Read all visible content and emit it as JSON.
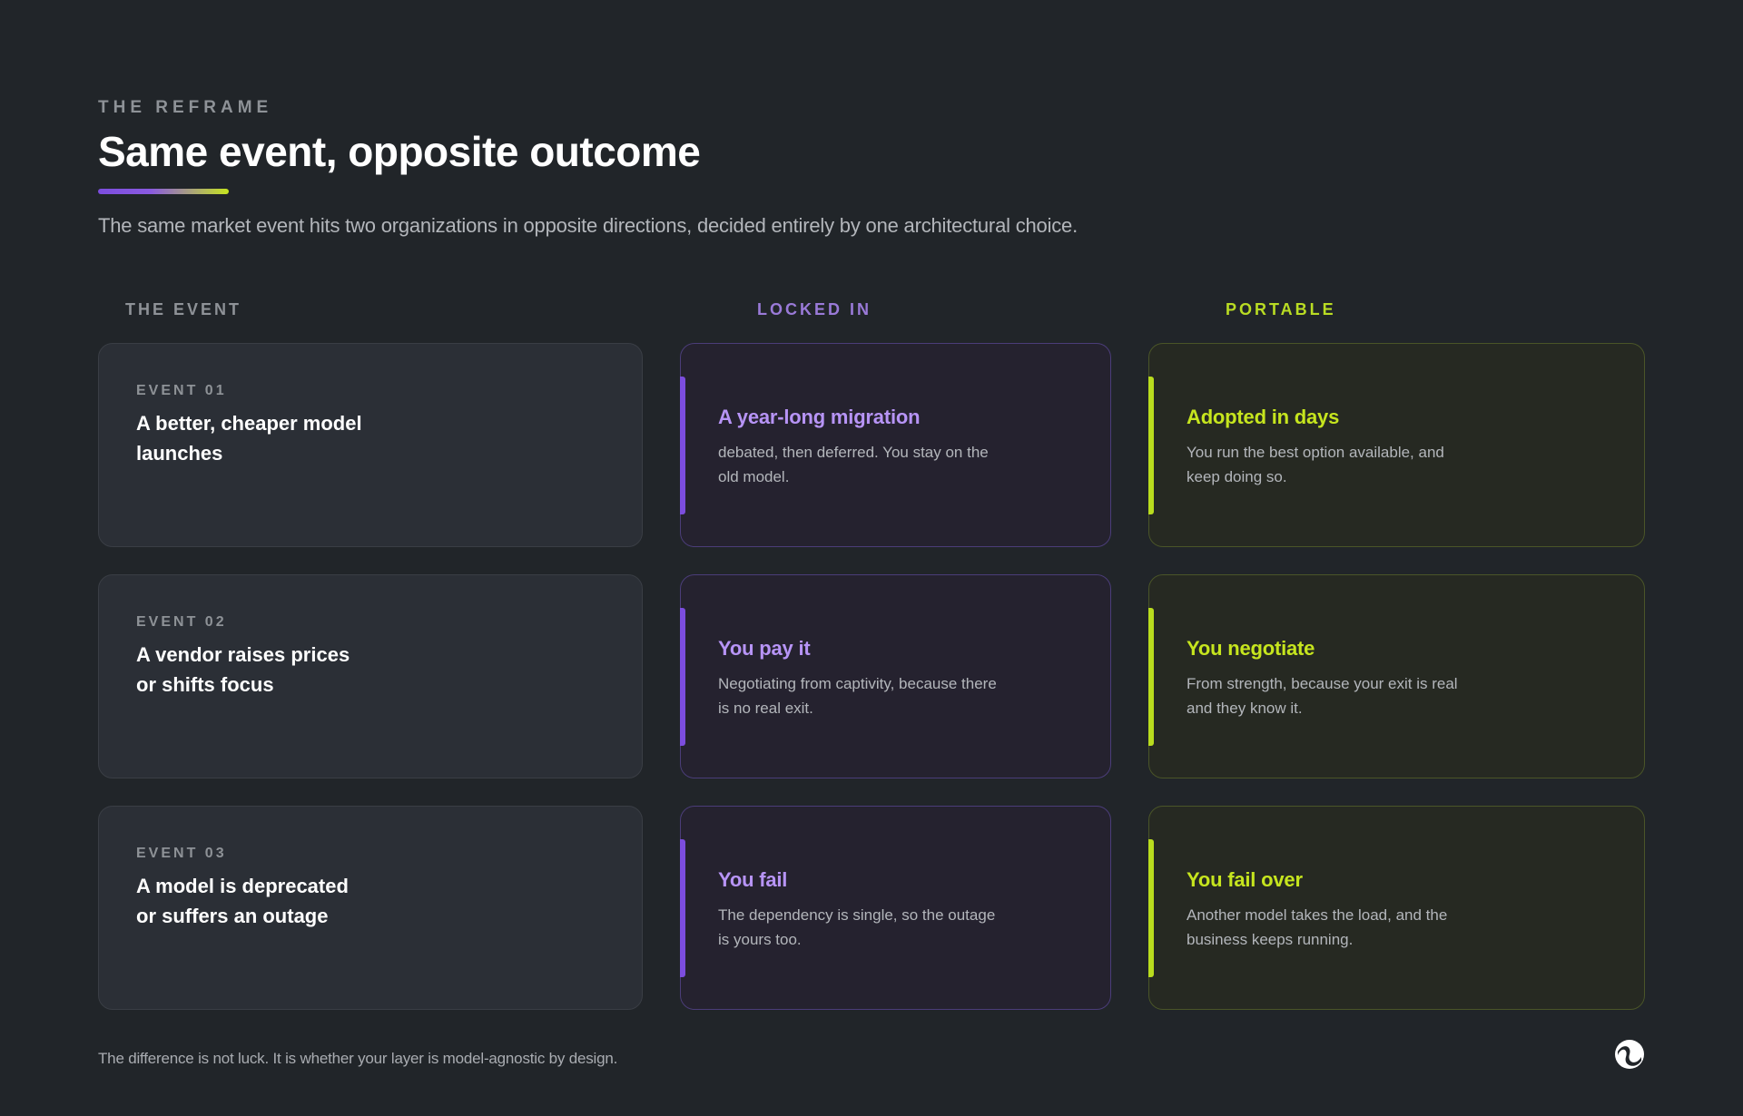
{
  "header": {
    "eyebrow": "THE REFRAME",
    "title": "Same event, opposite outcome",
    "subtitle": "The same market event hits two organizations in opposite directions, decided entirely by one architectural choice."
  },
  "columns": {
    "event": "THE EVENT",
    "locked": "LOCKED IN",
    "portable": "PORTABLE"
  },
  "rows": [
    {
      "event_label": "EVENT 01",
      "event_text": "A better, cheaper model launches",
      "locked_title": "A year-long migration",
      "locked_text": "debated, then deferred. You stay on the old model.",
      "portable_title": "Adopted in days",
      "portable_text": "You run the best option available, and keep doing so."
    },
    {
      "event_label": "EVENT 02",
      "event_text": "A vendor raises prices or shifts focus",
      "locked_title": "You pay it",
      "locked_text": "Negotiating from captivity, because there is no real exit.",
      "portable_title": "You negotiate",
      "portable_text": "From strength, because your exit is real and they know it."
    },
    {
      "event_label": "EVENT 03",
      "event_text": "A model is deprecated or suffers an outage",
      "locked_title": "You fail",
      "locked_text": "The dependency is single, so the outage is yours too.",
      "portable_title": "You fail over",
      "portable_text": "Another model takes the load, and the business keeps running."
    }
  ],
  "footer": "The difference is not luck. It is whether your layer is model-agnostic by design.",
  "colors": {
    "background": "#212529",
    "locked_accent": "#7c4dde",
    "locked_title": "#b794f6",
    "portable_accent": "#c6e51e"
  },
  "icons": {
    "logo": "brand-logo-icon"
  }
}
